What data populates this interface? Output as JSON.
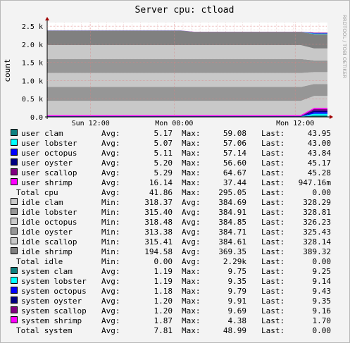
{
  "chart_data": {
    "type": "area",
    "title": "Server cpu: ctload",
    "ylabel": "count",
    "side_label": "RRDTOOL / TOBI OETIKER",
    "ylim": [
      0,
      2600
    ],
    "y_ticks": [
      {
        "value": 0,
        "label": "0.0"
      },
      {
        "value": 500,
        "label": "0.5 k"
      },
      {
        "value": 1000,
        "label": "1.0 k"
      },
      {
        "value": 1500,
        "label": "1.5 k"
      },
      {
        "value": 2000,
        "label": "2.0 k"
      },
      {
        "value": 2500,
        "label": "2.5 k"
      }
    ],
    "x_ticks": [
      {
        "t": 0.155,
        "label": "Sun 12:00"
      },
      {
        "t": 0.453,
        "label": "Mon 00:00"
      },
      {
        "t": 0.885,
        "label": "Mon 12:00"
      }
    ],
    "grid": true,
    "stack_note": "stacked: user series at base, then idle series, system series on top",
    "series": [
      {
        "name": "user clam",
        "color": "#0f8080",
        "values": [
          5,
          5,
          5,
          5,
          5,
          5,
          5,
          5,
          5,
          5,
          5,
          5,
          5,
          5,
          5,
          5,
          5,
          5,
          5,
          5,
          44,
          44
        ]
      },
      {
        "name": "user lobster",
        "color": "#00ffff",
        "values": [
          5,
          5,
          5,
          5,
          5,
          5,
          5,
          5,
          5,
          5,
          5,
          5,
          5,
          5,
          5,
          5,
          5,
          5,
          5,
          5,
          43,
          43
        ]
      },
      {
        "name": "user octopus",
        "color": "#0000ff",
        "values": [
          5,
          5,
          5,
          5,
          5,
          5,
          5,
          5,
          5,
          5,
          5,
          5,
          5,
          5,
          5,
          5,
          5,
          5,
          5,
          5,
          44,
          44
        ]
      },
      {
        "name": "user oyster",
        "color": "#000080",
        "values": [
          5,
          5,
          5,
          5,
          5,
          5,
          5,
          5,
          5,
          5,
          5,
          5,
          5,
          5,
          5,
          5,
          5,
          5,
          5,
          5,
          45,
          45
        ]
      },
      {
        "name": "user scallop",
        "color": "#800080",
        "values": [
          5,
          5,
          5,
          5,
          5,
          5,
          5,
          5,
          5,
          5,
          5,
          5,
          5,
          5,
          5,
          5,
          5,
          5,
          5,
          5,
          45,
          45
        ]
      },
      {
        "name": "user shrimp",
        "color": "#ff00ff",
        "values": [
          30,
          30,
          30,
          30,
          30,
          30,
          30,
          30,
          30,
          30,
          30,
          30,
          30,
          30,
          30,
          30,
          30,
          30,
          30,
          30,
          30,
          30
        ]
      },
      {
        "name": "idle clam",
        "color": "#c8c8c8",
        "values": [
          385,
          385,
          385,
          385,
          385,
          385,
          385,
          385,
          385,
          385,
          385,
          385,
          385,
          385,
          385,
          385,
          385,
          385,
          385,
          385,
          328,
          328
        ]
      },
      {
        "name": "idle lobster",
        "color": "#969696",
        "values": [
          385,
          385,
          385,
          385,
          385,
          385,
          385,
          385,
          385,
          385,
          385,
          385,
          385,
          385,
          385,
          385,
          385,
          385,
          385,
          385,
          329,
          329
        ]
      },
      {
        "name": "idle octopus",
        "color": "#c8c8c8",
        "values": [
          385,
          385,
          385,
          385,
          385,
          385,
          385,
          385,
          385,
          385,
          385,
          385,
          385,
          385,
          385,
          385,
          385,
          385,
          385,
          385,
          326,
          326
        ]
      },
      {
        "name": "idle oyster",
        "color": "#969696",
        "values": [
          385,
          385,
          385,
          385,
          385,
          385,
          385,
          385,
          385,
          385,
          385,
          385,
          385,
          385,
          385,
          385,
          385,
          385,
          385,
          385,
          325,
          325
        ]
      },
      {
        "name": "idle scallop",
        "color": "#c8c8c8",
        "values": [
          385,
          385,
          385,
          385,
          385,
          385,
          385,
          385,
          385,
          385,
          385,
          385,
          385,
          385,
          385,
          385,
          385,
          385,
          385,
          385,
          328,
          328
        ]
      },
      {
        "name": "idle shrimp",
        "color": "#808080",
        "values": [
          395,
          395,
          395,
          395,
          395,
          395,
          395,
          395,
          395,
          395,
          395,
          360,
          360,
          360,
          360,
          360,
          360,
          360,
          360,
          360,
          389,
          389
        ]
      },
      {
        "name": "system clam",
        "color": "#0f8080",
        "values": [
          1,
          1,
          1,
          1,
          1,
          1,
          1,
          1,
          1,
          1,
          1,
          1,
          1,
          1,
          1,
          1,
          1,
          1,
          1,
          1,
          9,
          9
        ]
      },
      {
        "name": "system lobster",
        "color": "#00ffff",
        "values": [
          1,
          1,
          1,
          1,
          1,
          1,
          1,
          1,
          1,
          1,
          1,
          1,
          1,
          1,
          1,
          1,
          1,
          1,
          1,
          1,
          9,
          9
        ]
      },
      {
        "name": "system octopus",
        "color": "#0000ff",
        "values": [
          1,
          1,
          1,
          1,
          1,
          1,
          1,
          1,
          1,
          1,
          1,
          1,
          1,
          1,
          1,
          1,
          1,
          1,
          1,
          1,
          9,
          9
        ]
      },
      {
        "name": "system oyster",
        "color": "#000080",
        "values": [
          1,
          1,
          1,
          1,
          1,
          1,
          1,
          1,
          1,
          1,
          1,
          1,
          1,
          1,
          1,
          1,
          1,
          1,
          1,
          1,
          9,
          9
        ]
      },
      {
        "name": "system scallop",
        "color": "#800080",
        "values": [
          1,
          1,
          1,
          1,
          1,
          1,
          1,
          1,
          1,
          1,
          1,
          1,
          1,
          1,
          1,
          1,
          1,
          1,
          1,
          1,
          9,
          9
        ]
      },
      {
        "name": "system shrimp",
        "color": "#ff00ff",
        "values": [
          2,
          2,
          2,
          2,
          2,
          2,
          2,
          2,
          2,
          2,
          2,
          2,
          2,
          2,
          2,
          2,
          2,
          2,
          2,
          2,
          2,
          2
        ]
      }
    ]
  },
  "legend_rows": [
    {
      "name": "user clam",
      "color": "#0f8080",
      "l1": "Avg:",
      "v1": "5.17",
      "l2": "Max:",
      "v2": "59.08",
      "l3": "Last:",
      "v3": "43.95"
    },
    {
      "name": "user lobster",
      "color": "#00ffff",
      "l1": "Avg:",
      "v1": "5.07",
      "l2": "Max:",
      "v2": "57.06",
      "l3": "Last:",
      "v3": "43.00"
    },
    {
      "name": "user octopus",
      "color": "#0000ff",
      "l1": "Avg:",
      "v1": "5.11",
      "l2": "Max:",
      "v2": "57.14",
      "l3": "Last:",
      "v3": "43.84"
    },
    {
      "name": "user oyster",
      "color": "#000080",
      "l1": "Avg:",
      "v1": "5.20",
      "l2": "Max:",
      "v2": "56.60",
      "l3": "Last:",
      "v3": "45.17"
    },
    {
      "name": "user scallop",
      "color": "#800080",
      "l1": "Avg:",
      "v1": "5.29",
      "l2": "Max:",
      "v2": "64.67",
      "l3": "Last:",
      "v3": "45.28"
    },
    {
      "name": "user shrimp",
      "color": "#ff00ff",
      "l1": "Avg:",
      "v1": "16.14",
      "l2": "Max:",
      "v2": "37.44",
      "l3": "Last:",
      "v3": "947.16m"
    },
    {
      "name": "Total cpu",
      "color": null,
      "l1": "Avg:",
      "v1": "41.86",
      "l2": "Max:",
      "v2": "295.05",
      "l3": "Last:",
      "v3": "0.00"
    },
    {
      "name": "idle clam",
      "color": "#c8c8c8",
      "l1": "Min:",
      "v1": "318.37",
      "l2": "Avg:",
      "v2": "384.69",
      "l3": "Last:",
      "v3": "328.29"
    },
    {
      "name": "idle lobster",
      "color": "#969696",
      "l1": "Min:",
      "v1": "315.40",
      "l2": "Avg:",
      "v2": "384.91",
      "l3": "Last:",
      "v3": "328.81"
    },
    {
      "name": "idle octopus",
      "color": "#c8c8c8",
      "l1": "Min:",
      "v1": "318.48",
      "l2": "Avg:",
      "v2": "384.85",
      "l3": "Last:",
      "v3": "326.23"
    },
    {
      "name": "idle oyster",
      "color": "#969696",
      "l1": "Min:",
      "v1": "313.38",
      "l2": "Avg:",
      "v2": "384.71",
      "l3": "Last:",
      "v3": "325.43"
    },
    {
      "name": "idle scallop",
      "color": "#c8c8c8",
      "l1": "Min:",
      "v1": "315.41",
      "l2": "Avg:",
      "v2": "384.61",
      "l3": "Last:",
      "v3": "328.14"
    },
    {
      "name": "idle shrimp",
      "color": "#808080",
      "l1": "Min:",
      "v1": "194.58",
      "l2": "Avg:",
      "v2": "369.35",
      "l3": "Last:",
      "v3": "389.32"
    },
    {
      "name": "Total idle",
      "color": null,
      "l1": "Min:",
      "v1": "0.00",
      "l2": "Avg:",
      "v2": "2.29k",
      "l3": "Last:",
      "v3": "0.00"
    },
    {
      "name": "system clam",
      "color": "#0f8080",
      "l1": "Avg:",
      "v1": "1.19",
      "l2": "Max:",
      "v2": "9.75",
      "l3": "Last:",
      "v3": "9.25"
    },
    {
      "name": "system lobster",
      "color": "#00ffff",
      "l1": "Avg:",
      "v1": "1.19",
      "l2": "Max:",
      "v2": "9.35",
      "l3": "Last:",
      "v3": "9.14"
    },
    {
      "name": "system octopus",
      "color": "#0000ff",
      "l1": "Avg:",
      "v1": "1.18",
      "l2": "Max:",
      "v2": "9.79",
      "l3": "Last:",
      "v3": "9.43"
    },
    {
      "name": "system oyster",
      "color": "#000080",
      "l1": "Avg:",
      "v1": "1.20",
      "l2": "Max:",
      "v2": "9.91",
      "l3": "Last:",
      "v3": "9.35"
    },
    {
      "name": "system scallop",
      "color": "#800080",
      "l1": "Avg:",
      "v1": "1.20",
      "l2": "Max:",
      "v2": "9.69",
      "l3": "Last:",
      "v3": "9.16"
    },
    {
      "name": "system shrimp",
      "color": "#ff00ff",
      "l1": "Avg:",
      "v1": "1.87",
      "l2": "Max:",
      "v2": "4.38",
      "l3": "Last:",
      "v3": "1.70"
    },
    {
      "name": "Total system",
      "color": null,
      "l1": "Avg:",
      "v1": "7.81",
      "l2": "Max:",
      "v2": "48.99",
      "l3": "Last:",
      "v3": "0.00"
    }
  ]
}
